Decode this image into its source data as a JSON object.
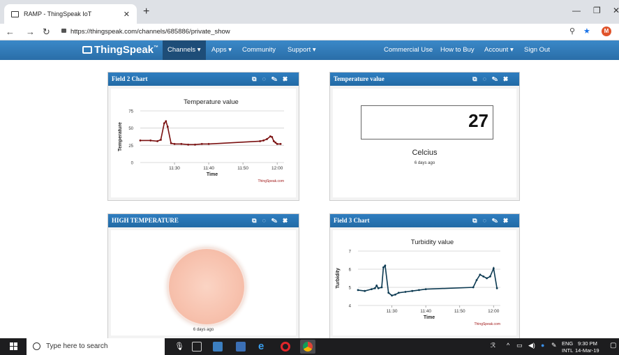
{
  "browser": {
    "tab_title": "RAMP - ThingSpeak IoT",
    "url": "https://thingspeak.com/channels/685886/private_show",
    "profile_initial": "M"
  },
  "nav": {
    "brand": "ThingSpeak",
    "brand_tm": "™",
    "items": [
      {
        "label": "Channels ▾",
        "active": true
      },
      {
        "label": "Apps ▾"
      },
      {
        "label": "Community"
      },
      {
        "label": "Support ▾"
      },
      {
        "label": "Commercial Use"
      },
      {
        "label": "How to Buy"
      },
      {
        "label": "Account ▾"
      },
      {
        "label": "Sign Out"
      }
    ]
  },
  "widgets": {
    "field2": {
      "title": "Field 2 Chart"
    },
    "tempvalue": {
      "title": "Temperature value",
      "value": "27",
      "unit": "Celcius",
      "ago": "6 days ago"
    },
    "hightemp": {
      "title": "HIGH TEMPERATURE",
      "ago": "6 days ago",
      "lamp_color": "#f7c1ad"
    },
    "field3": {
      "title": "Field 3 Chart"
    }
  },
  "chart_data": [
    {
      "type": "line",
      "title": "Temperature value",
      "xlabel": "Time",
      "ylabel": "Temperature",
      "credit": "ThingSpeak.com",
      "ylim": [
        0,
        75
      ],
      "yticks": [
        "0",
        "25",
        "50",
        "75"
      ],
      "xticks": [
        "11:30",
        "11:40",
        "11:50",
        "12:00"
      ],
      "color": "#7a1010",
      "series": [
        {
          "values": [
            {
              "x": "11:20",
              "y": 32
            },
            {
              "x": "11:23",
              "y": 32
            },
            {
              "x": "11:25",
              "y": 31
            },
            {
              "x": "11:26",
              "y": 33
            },
            {
              "x": "11:27",
              "y": 57
            },
            {
              "x": "11:27.5",
              "y": 60
            },
            {
              "x": "11:28",
              "y": 52
            },
            {
              "x": "11:29",
              "y": 28
            },
            {
              "x": "11:30",
              "y": 27
            },
            {
              "x": "11:32",
              "y": 27
            },
            {
              "x": "11:34",
              "y": 26
            },
            {
              "x": "11:36",
              "y": 26
            },
            {
              "x": "11:38",
              "y": 27
            },
            {
              "x": "11:40",
              "y": 27
            },
            {
              "x": "11:55",
              "y": 31
            },
            {
              "x": "11:56",
              "y": 32
            },
            {
              "x": "11:57",
              "y": 34
            },
            {
              "x": "11:58",
              "y": 38
            },
            {
              "x": "11:58.5",
              "y": 37
            },
            {
              "x": "11:59",
              "y": 31
            },
            {
              "x": "11:59.5",
              "y": 29
            },
            {
              "x": "12:00",
              "y": 27
            },
            {
              "x": "12:01",
              "y": 27
            }
          ]
        }
      ]
    },
    {
      "type": "line",
      "title": "Turbidity value",
      "xlabel": "Time",
      "ylabel": "Turbidity",
      "credit": "ThingSpeak.com",
      "ylim": [
        4,
        7
      ],
      "yticks": [
        "4",
        "5",
        "6",
        "7"
      ],
      "xticks": [
        "11:30",
        "11:40",
        "11:50",
        "12:00"
      ],
      "color": "#0c3a52",
      "series": [
        {
          "values": [
            {
              "x": "11:20",
              "y": 4.85
            },
            {
              "x": "11:22",
              "y": 4.8
            },
            {
              "x": "11:24",
              "y": 4.9
            },
            {
              "x": "11:25",
              "y": 4.95
            },
            {
              "x": "11:25.5",
              "y": 5.1
            },
            {
              "x": "11:26",
              "y": 4.95
            },
            {
              "x": "11:27",
              "y": 5.0
            },
            {
              "x": "11:27.5",
              "y": 6.1
            },
            {
              "x": "11:28",
              "y": 6.2
            },
            {
              "x": "11:29",
              "y": 4.7
            },
            {
              "x": "11:30",
              "y": 4.55
            },
            {
              "x": "11:31",
              "y": 4.6
            },
            {
              "x": "11:32",
              "y": 4.7
            },
            {
              "x": "11:34",
              "y": 4.75
            },
            {
              "x": "11:36",
              "y": 4.8
            },
            {
              "x": "11:38",
              "y": 4.85
            },
            {
              "x": "11:40",
              "y": 4.9
            },
            {
              "x": "11:54",
              "y": 5.0
            },
            {
              "x": "11:55",
              "y": 5.4
            },
            {
              "x": "11:56",
              "y": 5.7
            },
            {
              "x": "11:57",
              "y": 5.6
            },
            {
              "x": "11:58",
              "y": 5.5
            },
            {
              "x": "11:59",
              "y": 5.6
            },
            {
              "x": "12:00",
              "y": 6.05
            },
            {
              "x": "12:01",
              "y": 4.95
            }
          ]
        }
      ]
    }
  ],
  "taskbar": {
    "search_placeholder": "Type here to search",
    "lang": "ENG",
    "layout": "INTL",
    "time": "9:30 PM",
    "date": "14-Mar-19"
  }
}
